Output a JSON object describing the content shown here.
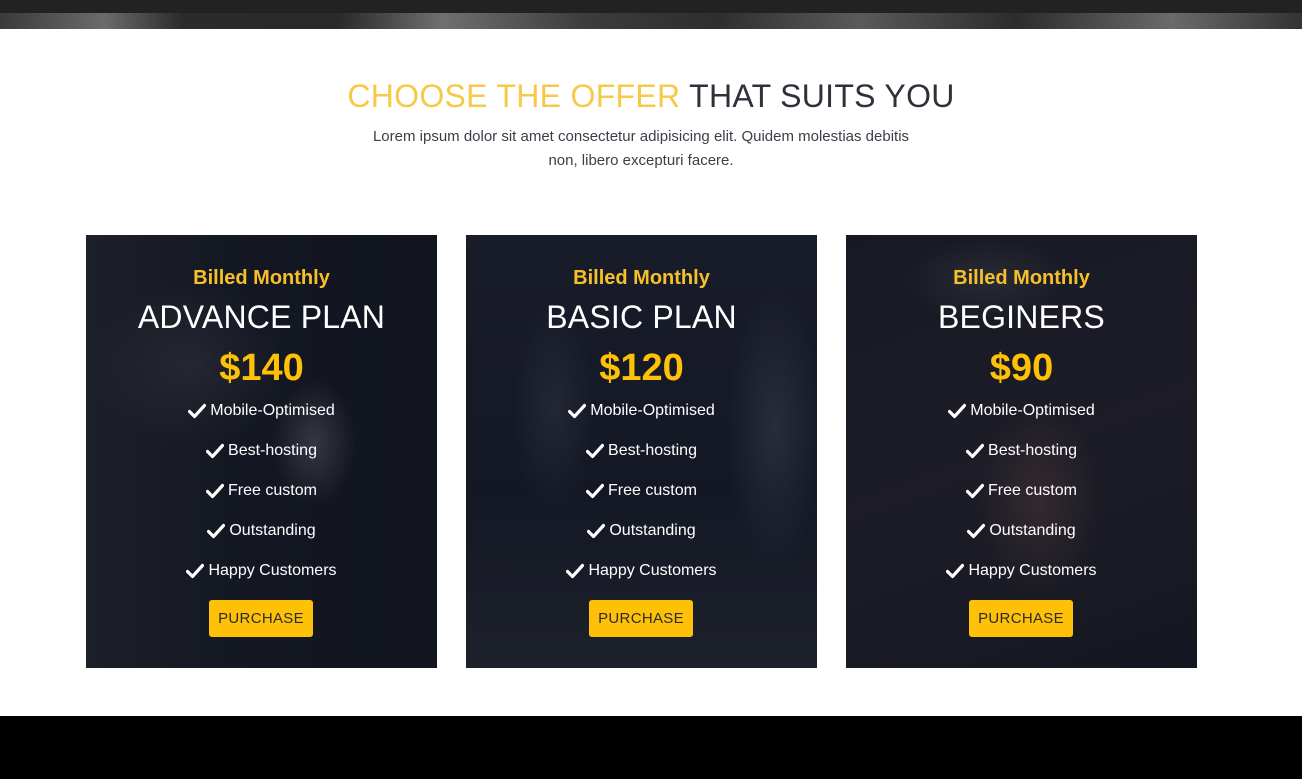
{
  "section": {
    "heading_accent": "CHOOSE THE OFFER",
    "heading_rest": "THAT SUITS YOU",
    "subtitle": "Lorem ipsum dolor sit amet consectetur adipisicing elit. Quidem molestias debitis non, libero excepturi facere."
  },
  "plans": [
    {
      "billing": "Billed Monthly",
      "name": "ADVANCE PLAN",
      "price": "$140",
      "features": [
        "Mobile-Optimised",
        "Best-hosting",
        "Free custom",
        "Outstanding",
        "Happy Customers"
      ],
      "button": "PURCHASE"
    },
    {
      "billing": "Billed Monthly",
      "name": "BASIC PLAN",
      "price": "$120",
      "features": [
        "Mobile-Optimised",
        "Best-hosting",
        "Free custom",
        "Outstanding",
        "Happy Customers"
      ],
      "button": "PURCHASE"
    },
    {
      "billing": "Billed Monthly",
      "name": "BEGINERS",
      "price": "$90",
      "features": [
        "Mobile-Optimised",
        "Best-hosting",
        "Free custom",
        "Outstanding",
        "Happy Customers"
      ],
      "button": "PURCHASE"
    }
  ],
  "colors": {
    "accent": "#f7c948",
    "price": "#ffc107",
    "button": "#ffc107",
    "heading_dark": "#2d3139"
  },
  "icons": {
    "feature_check": "check-icon"
  }
}
